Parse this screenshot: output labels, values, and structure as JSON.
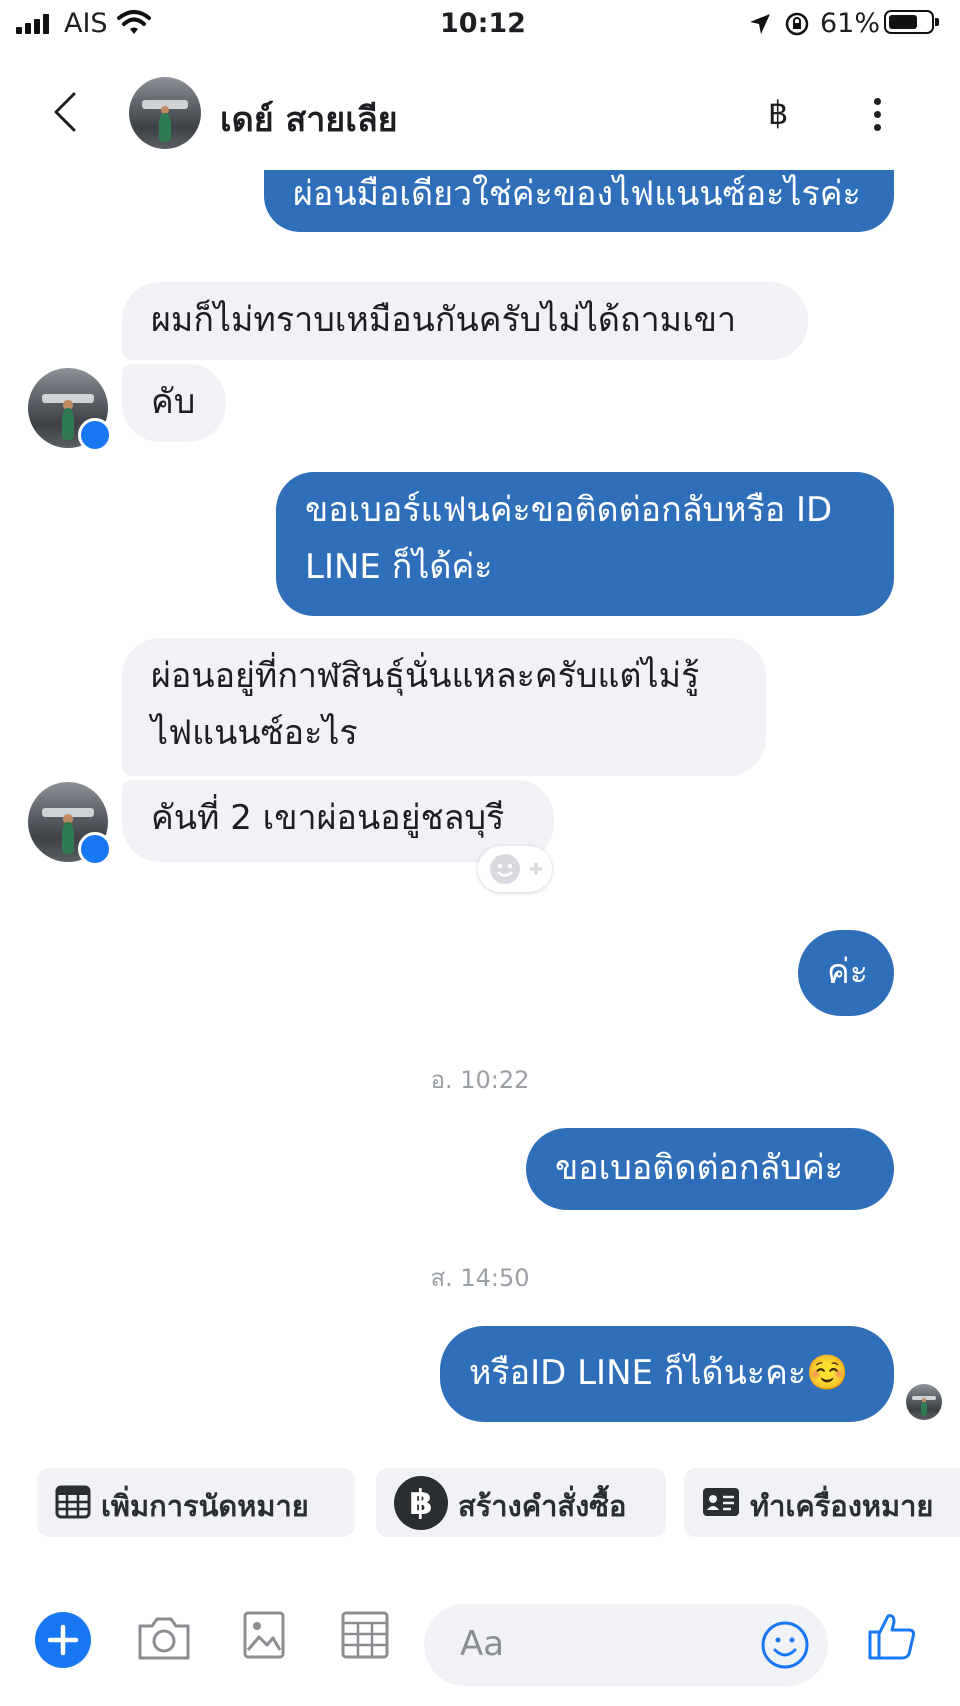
{
  "status_bar": {
    "carrier": "AIS",
    "time": "10:12",
    "battery": "61%",
    "battery_level": 0.61
  },
  "header": {
    "contact_name": "เดย์ สายเลีย",
    "payment_glyph": "฿",
    "more_glyph": "⋮"
  },
  "messages": {
    "m0": "ผ่อนมือเดียวใช่ค่ะของไฟแนนซ์อะไรค่ะ",
    "m1": "ผมก็ไม่ทราบเหมือนกันครับไม่ได้ถามเขา",
    "m2": "คับ",
    "m3": "ขอเบอร์แฟนค่ะขอติดต่อกลับหรือ ID LINE ก็ได้ค่ะ",
    "m4": "ผ่อนอยู่ที่กาฬสินธุ์นั่นแหละครับแต่ไม่รู้ไฟแนนซ์อะไร",
    "m5": "คันที่ 2 เขาผ่อนอยู่ชลบุรี",
    "m6": "ค่ะ",
    "m7": "ขอเบอติดต่อกลับค่ะ",
    "m8": "หรือID LINE ก็ได้นะคะ☺️"
  },
  "timestamps": {
    "t1": "อ. 10:22",
    "t2": "ส. 14:50"
  },
  "quick_actions": {
    "appointment": "เพิ่มการนัดหมาย",
    "order": "สร้างคำสั่งซื้อ",
    "label": "ทำเครื่องหมาย"
  },
  "composer": {
    "placeholder": "Aa"
  },
  "colors": {
    "outgoing_bubble": "#2f6fba",
    "incoming_bubble": "#f1f2f6",
    "accent": "#1877f2"
  }
}
